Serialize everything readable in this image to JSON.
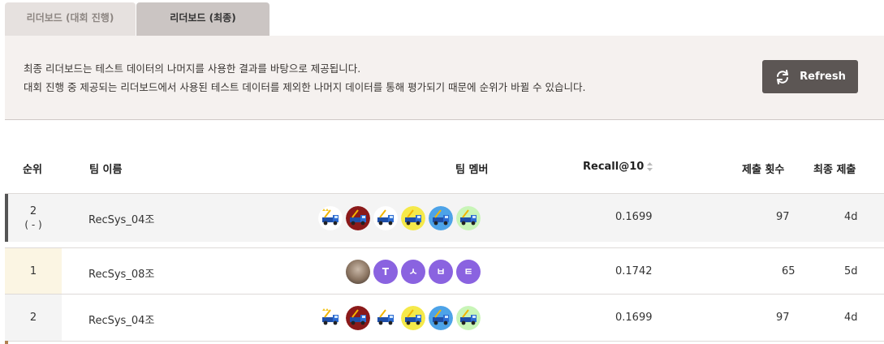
{
  "tabs": [
    {
      "label": "리더보드 (대회 진행)",
      "active": false
    },
    {
      "label": "리더보드 (최종)",
      "active": true
    }
  ],
  "info": {
    "line1": "최종 리더보드는 테스트 데이터의 나머지를 사용한 결과를 바탕으로 제공됩니다.",
    "line2": "대회 진행 중 제공되는 리더보드에서 사용된 테스트 데이터를 제외한 나머지 데이터를 통해 평가되기 때문에 순위가 바뀔 수 있습니다.",
    "refresh_label": "Refresh",
    "refresh_icon": "refresh-icon"
  },
  "table": {
    "headers": {
      "rank": "순위",
      "team_name": "팀 이름",
      "team_members": "팀 멤버",
      "metric": "Recall@10",
      "submissions": "제출 횟수",
      "last_submission": "최종 제출"
    },
    "my_row": {
      "rank": "2",
      "rank_change": "( - )",
      "team": "RecSys_04조",
      "score": "0.1699",
      "submissions": "97",
      "last": "4d"
    },
    "rows": [
      {
        "rank": "1",
        "team": "RecSys_08조",
        "score": "0.1742",
        "submissions": "65",
        "last": "5d"
      },
      {
        "rank": "2",
        "team": "RecSys_04조",
        "score": "0.1699",
        "submissions": "97",
        "last": "4d"
      }
    ],
    "members_08": [
      "photo",
      "T",
      "ㅅ",
      "ㅂ",
      "ㅌ"
    ],
    "members_04": [
      "crane-truck",
      "crane-truck",
      "crane-truck",
      "crane-truck",
      "crane-truck",
      "crane-truck"
    ]
  },
  "colors": {
    "rank_1": "#d4b04a",
    "rank_2": "#c4c4c4",
    "my_team": "#555555",
    "letter_avatar": "#8a63e0",
    "refresh_button": "#5c5654"
  }
}
